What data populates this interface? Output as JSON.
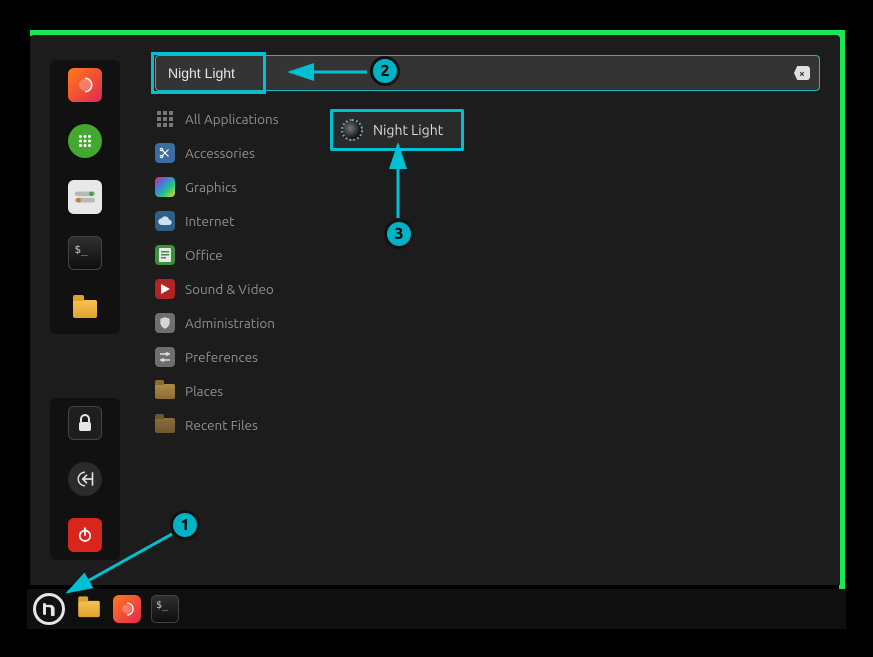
{
  "search": {
    "value": "Night Light"
  },
  "favorites": {
    "top": [
      {
        "id": "firefox",
        "name": "firefox-icon"
      },
      {
        "id": "apps",
        "name": "apps-icon"
      },
      {
        "id": "settings",
        "name": "settings-icon"
      },
      {
        "id": "terminal",
        "name": "terminal-icon"
      },
      {
        "id": "files",
        "name": "files-icon"
      }
    ],
    "bottom": [
      {
        "id": "lock",
        "name": "lock-icon"
      },
      {
        "id": "logout",
        "name": "logout-icon"
      },
      {
        "id": "power",
        "name": "power-icon"
      }
    ]
  },
  "categories": [
    {
      "id": "all",
      "label": "All Applications"
    },
    {
      "id": "accessories",
      "label": "Accessories"
    },
    {
      "id": "graphics",
      "label": "Graphics"
    },
    {
      "id": "internet",
      "label": "Internet"
    },
    {
      "id": "office",
      "label": "Office"
    },
    {
      "id": "sound",
      "label": "Sound & Video"
    },
    {
      "id": "administration",
      "label": "Administration"
    },
    {
      "id": "preferences",
      "label": "Preferences"
    },
    {
      "id": "places",
      "label": "Places"
    },
    {
      "id": "recent",
      "label": "Recent Files"
    }
  ],
  "results": [
    {
      "id": "night-light",
      "label": "Night Light"
    }
  ],
  "taskbar": [
    {
      "id": "menu",
      "name": "menu-launcher"
    },
    {
      "id": "files",
      "name": "taskbar-files-icon"
    },
    {
      "id": "firefox",
      "name": "taskbar-firefox-icon"
    },
    {
      "id": "terminal",
      "name": "taskbar-terminal-icon"
    }
  ],
  "annotations": [
    {
      "n": "1"
    },
    {
      "n": "2"
    },
    {
      "n": "3"
    }
  ]
}
